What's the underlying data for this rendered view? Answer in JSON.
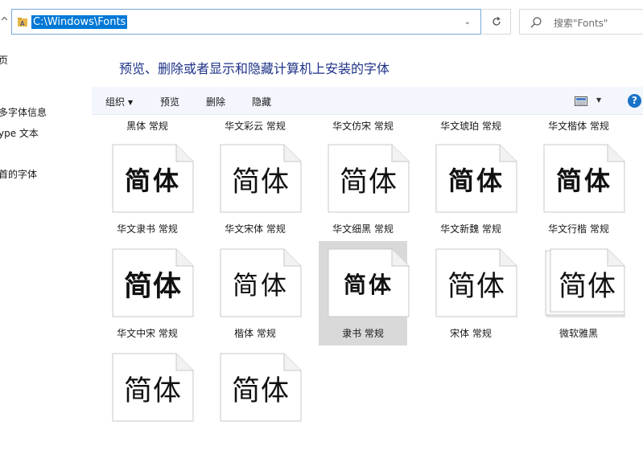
{
  "address_bar": {
    "path": "C:\\Windows\\Fonts"
  },
  "search": {
    "placeholder": "搜索\"Fonts\""
  },
  "nav": {
    "items": [
      "页",
      "多字体信息",
      "ype 文本",
      "首的字体"
    ]
  },
  "page_heading": "预览、删除或者显示和隐藏计算机上安装的字体",
  "toolbar": {
    "organize": "组织",
    "preview": "预览",
    "delete": "删除",
    "hide": "隐藏",
    "help": "?"
  },
  "top_row_labels": [
    "黑体 常规",
    "华文彩云 常规",
    "华文仿宋 常规",
    "华文琥珀 常规",
    "华文楷体 常规"
  ],
  "sample_text": "简体",
  "fonts": [
    {
      "label": "华文隶书 常规",
      "stacked": false,
      "selected": false
    },
    {
      "label": "华文宋体 常规",
      "stacked": false,
      "selected": false
    },
    {
      "label": "华文细黑 常规",
      "stacked": false,
      "selected": false
    },
    {
      "label": "华文新魏 常规",
      "stacked": false,
      "selected": false
    },
    {
      "label": "华文行楷 常规",
      "stacked": false,
      "selected": false
    },
    {
      "label": "华文中宋 常规",
      "stacked": false,
      "selected": false
    },
    {
      "label": "楷体 常规",
      "stacked": false,
      "selected": false
    },
    {
      "label": "隶书 常规",
      "stacked": false,
      "selected": true
    },
    {
      "label": "宋体 常规",
      "stacked": false,
      "selected": false
    },
    {
      "label": "微软雅黑",
      "stacked": true,
      "selected": false
    },
    {
      "label": "",
      "stacked": false,
      "selected": false
    },
    {
      "label": "",
      "stacked": false,
      "selected": false
    }
  ],
  "colors": {
    "accent": "#0078d7",
    "heading": "#1e3287",
    "toolbar_bg": "#f3f6fc",
    "selected_bg": "#d9d9d9"
  }
}
